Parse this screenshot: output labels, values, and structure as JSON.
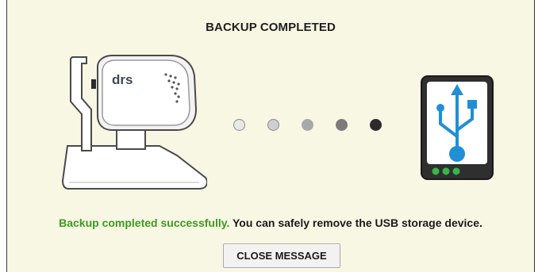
{
  "dialog": {
    "title": "BACKUP COMPLETED",
    "device": {
      "brand_label": "drs",
      "icon": "drs-device-icon"
    },
    "progress_dots": {
      "count": 5,
      "colors": [
        "#e8e8e8",
        "#cfcfcf",
        "#a9a9a9",
        "#7b7b7b",
        "#2b2b2b"
      ]
    },
    "usb_icon": "usb-storage-icon",
    "message": {
      "success_text": "Backup completed successfully.",
      "detail_text": " You can safely remove the USB storage device."
    },
    "close_button_label": "CLOSE MESSAGE"
  },
  "colors": {
    "background": "#f8f7e3",
    "success": "#3c9a1f",
    "usb_blue": "#1f8fd6",
    "usb_led": "#3bb54a"
  }
}
